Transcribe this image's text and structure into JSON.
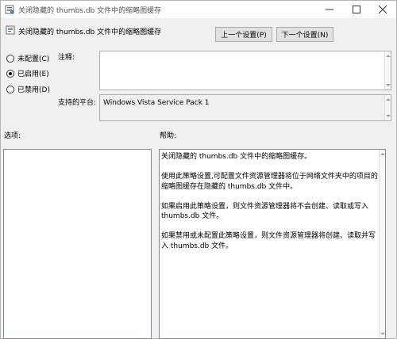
{
  "window": {
    "title": "关闭隐藏的 thumbs.db 文件中的缩略图缓存"
  },
  "header": {
    "setting_name": "关闭隐藏的 thumbs.db 文件中的缩略图缓存",
    "prev_button": "上一个设置(P)",
    "next_button": "下一个设置(N)"
  },
  "state": {
    "options": [
      {
        "label": "未配置(C)",
        "selected": false
      },
      {
        "label": "已启用(E)",
        "selected": true
      },
      {
        "label": "已禁用(D)",
        "selected": false
      }
    ]
  },
  "comment": {
    "label": "注释:",
    "value": ""
  },
  "platform": {
    "label": "支持的平台:",
    "value": "Windows Vista Service Pack 1"
  },
  "options_pane": {
    "label": "选项:"
  },
  "help_pane": {
    "label": "帮助:",
    "paragraphs": [
      "关闭隐藏的 thumbs.db 文件中的缩略图缓存。",
      "使用此策略设置,可配置文件资源管理器将位于网络文件夹中的项目的缩略图缓存在隐藏的 thumbs.db 文件中。",
      "如果启用此策略设置，则文件资源管理器将不会创建、读取或写入 thumbs.db 文件。",
      "如果禁用或未配置此策略设置，则文件资源管理器将创建、读取并写入 thumbs.db 文件。"
    ]
  },
  "colors": {
    "window_bg": "#f0f0f0",
    "button_bg": "#e1e1e1",
    "border": "#adadad"
  }
}
